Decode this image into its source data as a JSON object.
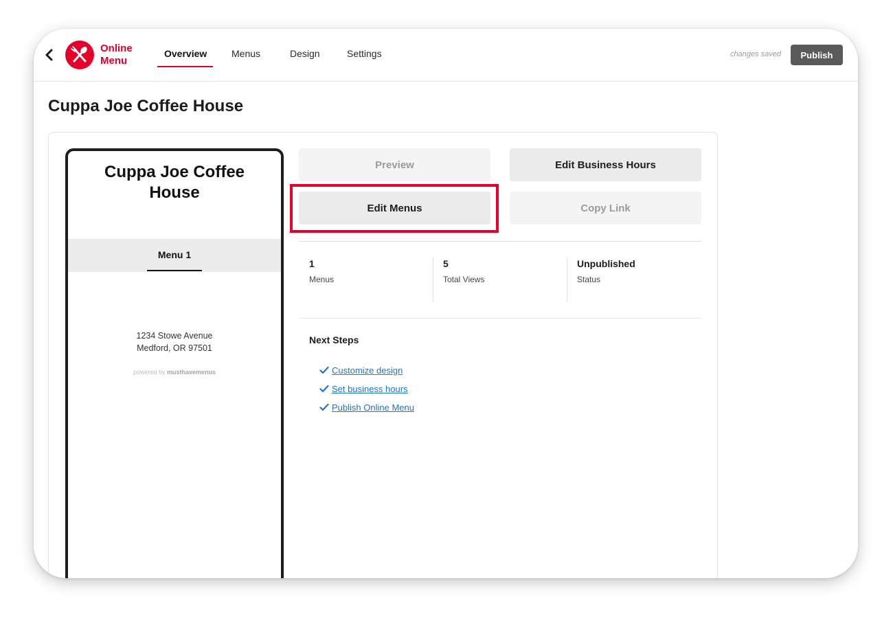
{
  "app": {
    "logo_line1": "Online",
    "logo_line2": "Menu"
  },
  "nav": {
    "tabs": [
      {
        "label": "Overview",
        "active": true
      },
      {
        "label": "Menus",
        "active": false
      },
      {
        "label": "Design",
        "active": false
      },
      {
        "label": "Settings",
        "active": false
      }
    ]
  },
  "header": {
    "save_status": "changes saved",
    "publish_label": "Publish"
  },
  "page": {
    "title": "Cuppa Joe Coffee House"
  },
  "preview": {
    "business_name_line1": "Cuppa Joe Coffee",
    "business_name_line2": "House",
    "menu_tab": "Menu 1",
    "address_line1": "1234 Stowe Avenue",
    "address_line2": "Medford, OR 97501",
    "powered_by_prefix": "powered by",
    "powered_by_brand": "musthavemenus"
  },
  "actions": {
    "preview": "Preview",
    "edit_business_hours": "Edit Business Hours",
    "edit_menus": "Edit Menus",
    "copy_link": "Copy Link"
  },
  "stats": [
    {
      "value": "1",
      "label": "Menus"
    },
    {
      "value": "5",
      "label": "Total Views"
    },
    {
      "value": "Unpublished",
      "label": "Status"
    }
  ],
  "next_steps": {
    "title": "Next Steps",
    "items": [
      {
        "label": "Customize design"
      },
      {
        "label": "Set business hours"
      },
      {
        "label": "Publish Online Menu"
      }
    ]
  },
  "colors": {
    "brand": "#e4002b",
    "link": "#1a73d9",
    "publish_button": "#5a5a5a"
  },
  "icons": {
    "back": "chevron-left-icon",
    "logo": "fork-spoon-icon",
    "check": "checkmark-icon"
  }
}
